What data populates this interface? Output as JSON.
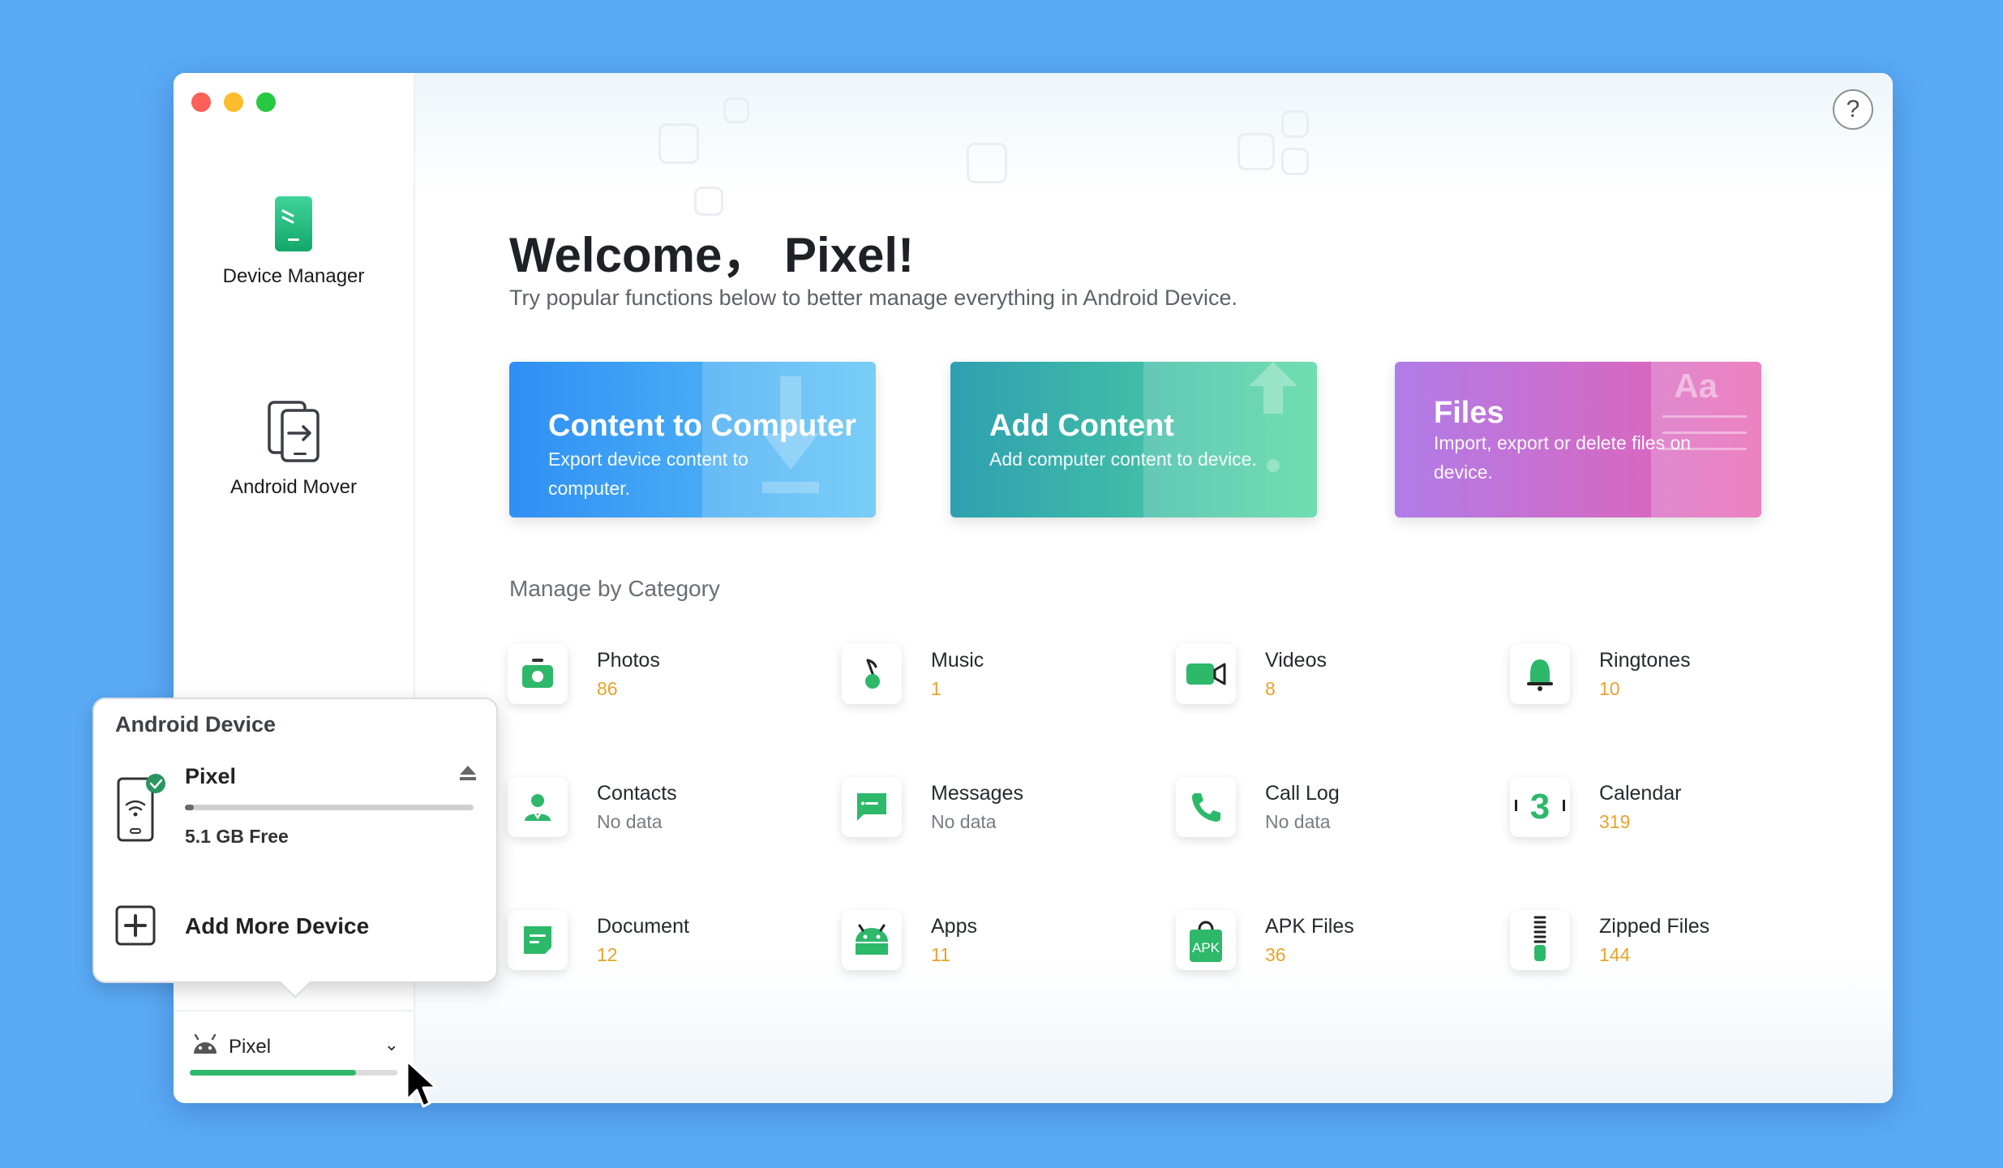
{
  "sidebar": {
    "items": [
      {
        "label": "Device Manager",
        "icon": "device-manager-icon"
      },
      {
        "label": "Android Mover",
        "icon": "android-mover-icon"
      }
    ],
    "device": {
      "name": "Pixel",
      "storage_used_fraction": 0.8
    }
  },
  "header": {
    "title": "Welcome， Pixel!",
    "subtitle": "Try popular functions below to better manage everything in Android Device.",
    "help": "?"
  },
  "cards": [
    {
      "title": "Content to Computer",
      "desc": "Export device content to computer."
    },
    {
      "title": "Add Content",
      "desc": "Add computer content to device."
    },
    {
      "title": "Files",
      "desc": "Import, export or delete files on device."
    }
  ],
  "categories_title": "Manage by Category",
  "categories": [
    {
      "name": "Photos",
      "count": "86",
      "icon": "photos-icon"
    },
    {
      "name": "Music",
      "count": "1",
      "icon": "music-icon"
    },
    {
      "name": "Videos",
      "count": "8",
      "icon": "videos-icon"
    },
    {
      "name": "Ringtones",
      "count": "10",
      "icon": "ringtones-icon"
    },
    {
      "name": "Contacts",
      "count": "No data",
      "icon": "contacts-icon"
    },
    {
      "name": "Messages",
      "count": "No data",
      "icon": "messages-icon"
    },
    {
      "name": "Call Log",
      "count": "No data",
      "icon": "call-log-icon"
    },
    {
      "name": "Calendar",
      "count": "319",
      "icon": "calendar-icon"
    },
    {
      "name": "Document",
      "count": "12",
      "icon": "document-icon"
    },
    {
      "name": "Apps",
      "count": "11",
      "icon": "apps-icon"
    },
    {
      "name": "APK Files",
      "count": "36",
      "icon": "apk-files-icon"
    },
    {
      "name": "Zipped Files",
      "count": "144",
      "icon": "zipped-files-icon"
    }
  ],
  "popup": {
    "heading": "Android Device",
    "device_name": "Pixel",
    "free": "5.1 GB Free",
    "storage_used_fraction": 0.03,
    "add_label": "Add More Device"
  },
  "icon_texts": {
    "calendar_day": "3",
    "apk": "APK",
    "files_aa": "Aa"
  },
  "colors": {
    "accent_green": "#2db86a",
    "count_orange": "#e7a32b",
    "background": "#5aaaf6"
  }
}
